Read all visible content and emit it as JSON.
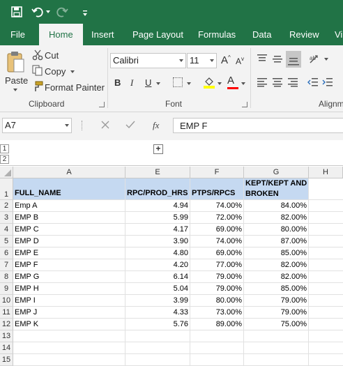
{
  "qat": {
    "save_icon": "save-icon",
    "undo_icon": "undo-icon",
    "redo_icon": "redo-icon",
    "customize_icon": "customize-qat-icon"
  },
  "tabs": [
    "File",
    "Home",
    "Insert",
    "Page Layout",
    "Formulas",
    "Data",
    "Review",
    "Vi"
  ],
  "active_tab": "Home",
  "clipboard": {
    "paste": "Paste",
    "cut": "Cut",
    "copy": "Copy",
    "format_painter": "Format Painter",
    "group_label": "Clipboard"
  },
  "font": {
    "family": "Calibri",
    "size": "11",
    "group_label": "Font",
    "bold": "B",
    "italic": "I",
    "underline": "U",
    "grow": "A",
    "shrink": "A",
    "font_color": "A",
    "highlight_color": "#ffff00",
    "font_color_value": "#ff0000"
  },
  "alignment": {
    "group_label": "Alignm"
  },
  "formula_bar": {
    "name_box": "A7",
    "fx": "fx",
    "content": "EMP F"
  },
  "outline": {
    "levels": [
      "1",
      "2"
    ],
    "expand": "+"
  },
  "columns": [
    "A",
    "E",
    "F",
    "G",
    "H"
  ],
  "rows": [
    "1",
    "2",
    "3",
    "4",
    "5",
    "6",
    "7",
    "8",
    "9",
    "10",
    "11",
    "12",
    "13",
    "14",
    "15"
  ],
  "header_row": [
    "FULL_NAME",
    "RPC/PROD_HRS",
    "PTPS/RPCS",
    "KEPT/KEPT AND",
    "BROKEN"
  ],
  "data_rows": [
    [
      "Emp A",
      "4.94",
      "74.00%",
      "84.00%"
    ],
    [
      "EMP B",
      "5.99",
      "72.00%",
      "82.00%"
    ],
    [
      "EMP C",
      "4.17",
      "69.00%",
      "80.00%"
    ],
    [
      "EMP D",
      "3.90",
      "74.00%",
      "87.00%"
    ],
    [
      "EMP E",
      "4.80",
      "69.00%",
      "85.00%"
    ],
    [
      "EMP F",
      "4.20",
      "77.00%",
      "82.00%"
    ],
    [
      "EMP G",
      "6.14",
      "79.00%",
      "82.00%"
    ],
    [
      "EMP H",
      "5.04",
      "79.00%",
      "85.00%"
    ],
    [
      "EMP I",
      "3.99",
      "80.00%",
      "79.00%"
    ],
    [
      "EMP J",
      "4.33",
      "73.00%",
      "79.00%"
    ],
    [
      "EMP K",
      "5.76",
      "89.00%",
      "75.00%"
    ]
  ]
}
